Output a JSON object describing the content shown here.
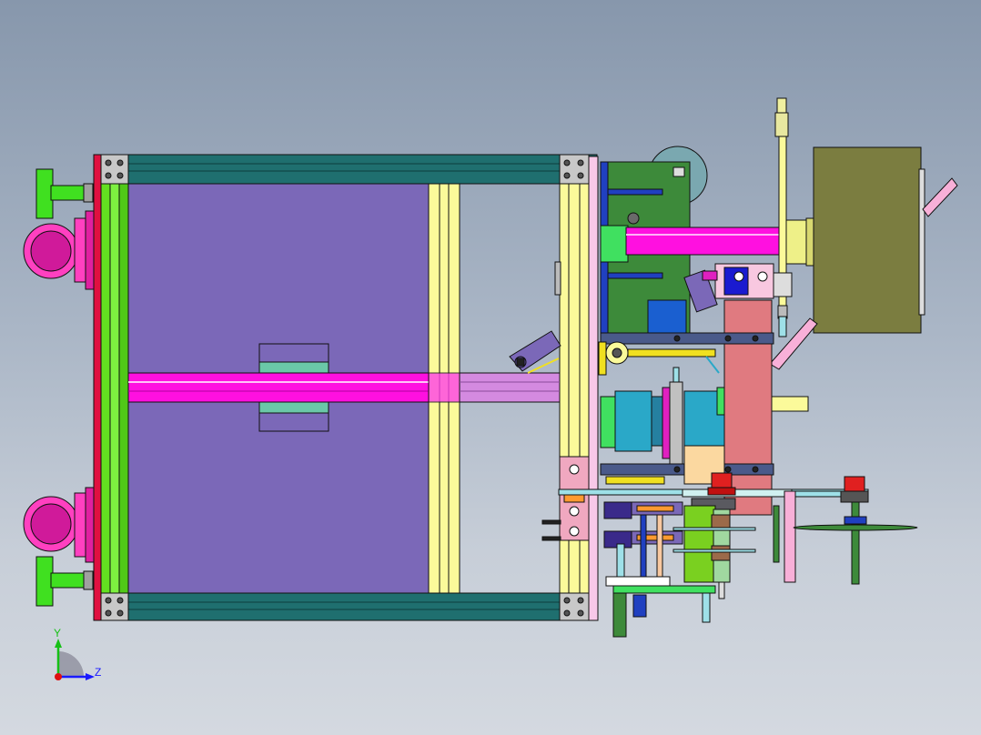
{
  "triad": {
    "y_label": "Y",
    "z_label": "Z",
    "y_color": "#16c016",
    "z_color": "#1a1aff",
    "origin_color": "#e01010"
  },
  "colors": {
    "frame_teal": "#1f6f6f",
    "side_green": "#63e020",
    "hopper_purple": "#7b68b8",
    "shaft_magenta": "#ff10e0",
    "pale_yellow": "#fbfa9a",
    "caster_pink": "#ff40c0",
    "foot_green": "#40e020",
    "board_green": "#3d8a3a",
    "motor_olive": "#7b7d40",
    "block_salmon": "#e07a80",
    "motor_cyan": "#2aa8c8",
    "gear_green": "#7ad020",
    "gear_brown": "#9c6a4a"
  }
}
